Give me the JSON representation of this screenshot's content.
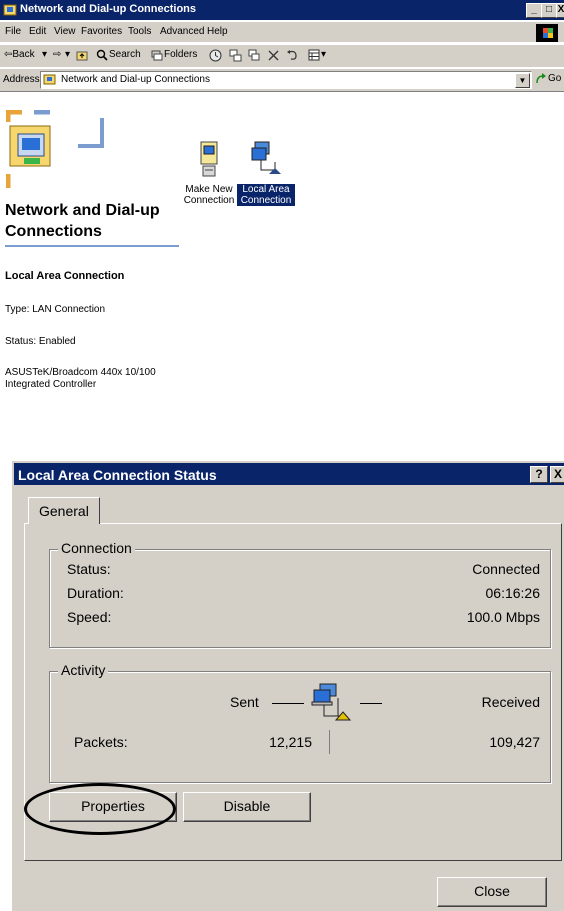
{
  "explorer": {
    "title": "Network and Dial-up Connections",
    "title_buttons": [
      "_",
      "□",
      "X"
    ],
    "menu": [
      "File",
      "Edit",
      "View",
      "Favorites",
      "Tools",
      "Advanced",
      "Help"
    ],
    "toolbar": {
      "back": "⇦Back",
      "back_arrow": "▾",
      "forward": "⇨",
      "forward_arrow": "▾",
      "search": "Search",
      "folders": "Folders",
      "views_arrow": "▾"
    },
    "address": {
      "label": "Address",
      "value": "Network and Dial-up Connections",
      "go": "Go"
    },
    "pane": {
      "heading_line1": "Network and Dial-up",
      "heading_line2": "Connections",
      "selected_name": "Local Area Connection",
      "type": "Type: LAN Connection",
      "status": "Status: Enabled",
      "device_line1": "ASUSTeK/Broadcom 440x 10/100",
      "device_line2": "Integrated Controller"
    },
    "icons": [
      {
        "line1": "Make New",
        "line2": "Connection"
      },
      {
        "line1": "Local Area",
        "line2": "Connection"
      }
    ],
    "colors": {
      "titlebar": "#0a246a",
      "chrome": "#d4d0c8",
      "heading_rule": "#7a9ccf"
    }
  },
  "dialog": {
    "title": "Local Area Connection Status",
    "help_button": "?",
    "close_x": "X",
    "tab": "General",
    "connection": {
      "legend": "Connection",
      "status_label": "Status:",
      "status_value": "Connected",
      "duration_label": "Duration:",
      "duration_value": "06:16:26",
      "speed_label": "Speed:",
      "speed_value": "100.0 Mbps"
    },
    "activity": {
      "legend": "Activity",
      "sent_label": "Sent",
      "received_label": "Received",
      "packets_label": "Packets:",
      "sent_value": "12,215",
      "received_value": "109,427"
    },
    "buttons": {
      "properties": "Properties",
      "disable": "Disable",
      "close": "Close"
    }
  }
}
